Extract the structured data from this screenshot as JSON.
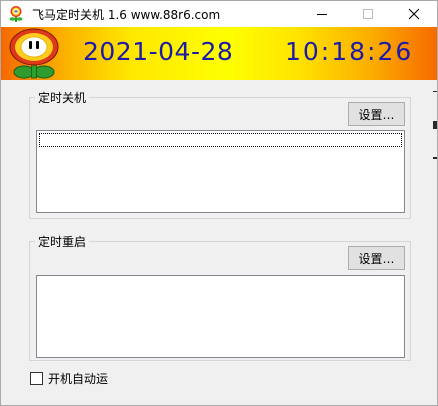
{
  "window": {
    "title": "飞马定时关机 1.6   www.88r6.com"
  },
  "banner": {
    "date": "2021-04-28",
    "time": "10:18:26"
  },
  "shutdown_group": {
    "label": "定时关机",
    "settings_button": "设置…"
  },
  "restart_group": {
    "label": "定时重启",
    "settings_button": "设置…"
  },
  "autostart": {
    "label": "开机自动运",
    "checked": false
  },
  "icons": {
    "app": "flower-icon",
    "minimize": "minimize-icon",
    "maximize": "maximize-icon",
    "close": "close-icon"
  },
  "colors": {
    "clock_text": "#1c1ca8",
    "banner_center": "#ffff00",
    "banner_edge": "#f56900"
  }
}
